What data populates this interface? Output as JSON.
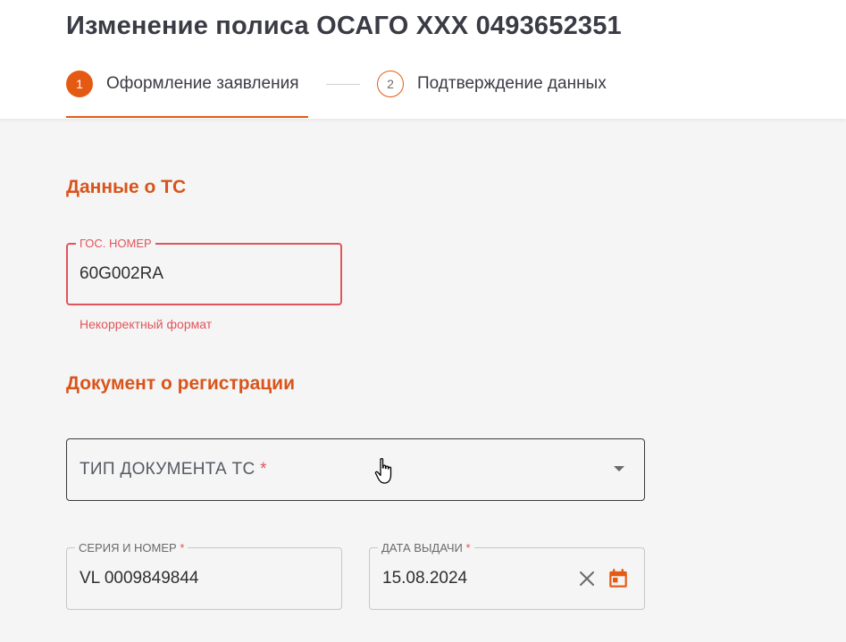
{
  "page": {
    "title": "Изменение полиса ОСАГО XXX 0493652351"
  },
  "stepper": {
    "steps": [
      {
        "number": "1",
        "label": "Оформление заявления",
        "state": "active"
      },
      {
        "number": "2",
        "label": "Подтверждение данных",
        "state": "inactive"
      }
    ]
  },
  "vehicle_section": {
    "title": "Данные о ТС",
    "plate_field": {
      "label": "ГОС. НОМЕР",
      "value": "60G002RA",
      "error": "Некорректный формат"
    }
  },
  "registration_section": {
    "title": "Документ о регистрации",
    "doc_type_select": {
      "placeholder": "ТИП ДОКУМЕНТА ТС",
      "required_mark": "*"
    },
    "series_number_field": {
      "label": "СЕРИЯ И НОМЕР",
      "required_mark": "*",
      "value": "VL 0009849844"
    },
    "issue_date_field": {
      "label": "ДАТА ВЫДАЧИ",
      "required_mark": "*",
      "value": "15.08.2024"
    }
  },
  "icons": {
    "clear": "close-icon",
    "calendar": "calendar-icon",
    "dropdown": "chevron-down-icon",
    "cursor": "hand-cursor-icon"
  },
  "colors": {
    "accent": "#e55a13",
    "section_title": "#d9541a",
    "error": "#e0555c",
    "background": "#f5f5f5"
  }
}
